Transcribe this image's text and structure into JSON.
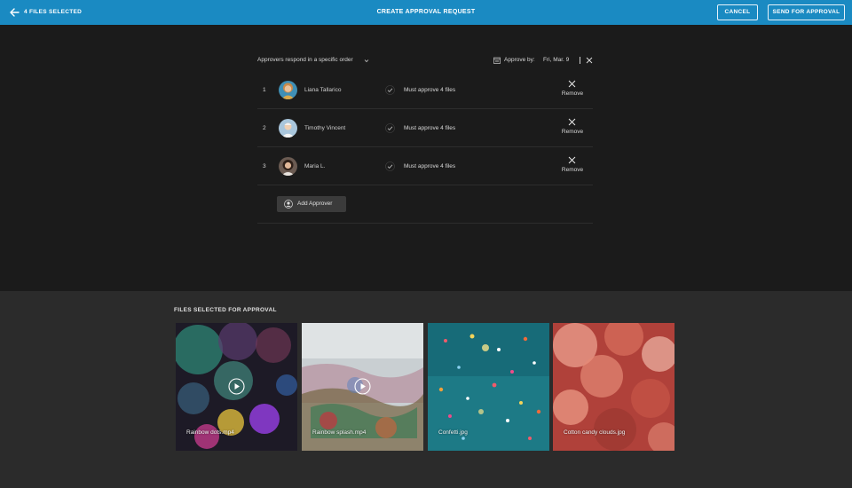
{
  "header": {
    "selected_count": "4 FILES SELECTED",
    "title": "CREATE APPROVAL REQUEST",
    "cancel_label": "CANCEL",
    "send_label": "SEND FOR APPROVAL",
    "bar_color": "#1a8ac2"
  },
  "approval": {
    "order_label": "Approvers respond in a specific order",
    "approve_by_label": "Approve by:",
    "approve_by_date": "Fri, Mar. 9",
    "approvers": [
      {
        "index": "1",
        "name": "Liana Tallarico",
        "requirement": "Must approve 4 files",
        "remove_label": "Remove"
      },
      {
        "index": "2",
        "name": "Timothy Vincent",
        "requirement": "Must approve 4 files",
        "remove_label": "Remove"
      },
      {
        "index": "3",
        "name": "Maria L.",
        "requirement": "Must approve 4 files",
        "remove_label": "Remove"
      }
    ],
    "add_label": "Add Approver"
  },
  "files": {
    "section_title": "FILES SELECTED FOR APPROVAL",
    "items": [
      {
        "name": "Rainbow dots.mp4",
        "type": "video"
      },
      {
        "name": "Rainbow splash.mp4",
        "type": "video"
      },
      {
        "name": "Confetti.jpg",
        "type": "image"
      },
      {
        "name": "Cotton candy clouds.jpg",
        "type": "image"
      }
    ]
  }
}
